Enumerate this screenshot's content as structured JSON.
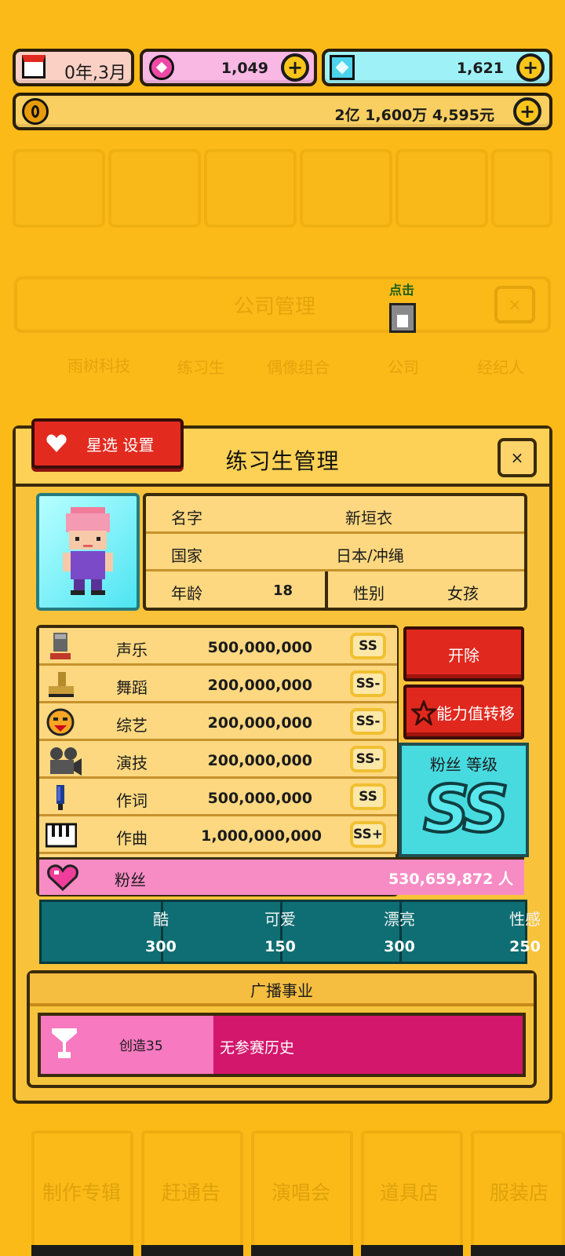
{
  "resources": {
    "date": "0年,3月",
    "gems_pink": "1,049",
    "gems_blue": "1,621",
    "money": "2亿 1,600万 4,595元",
    "plus": "+"
  },
  "background": {
    "company_title": "公司管理",
    "tabs": [
      "雨树科技",
      "练习生",
      "偶像组合",
      "公司",
      "经纪人"
    ],
    "click_hint": "点击",
    "nav": [
      "制作专辑",
      "赶通告",
      "演唱会",
      "道具店",
      "服装店"
    ]
  },
  "panel": {
    "title": "练习生管理",
    "star_setting": "星选 设置",
    "close": "×"
  },
  "profile": {
    "name_label": "名字",
    "name": "新垣衣",
    "country_label": "国家",
    "country": "日本/冲绳",
    "age_label": "年龄",
    "age": "18",
    "gender_label": "性别",
    "gender": "女孩"
  },
  "stats": [
    {
      "label": "声乐",
      "value": "500,000,000",
      "grade": "SS",
      "icon": "microphone-icon"
    },
    {
      "label": "舞蹈",
      "value": "200,000,000",
      "grade": "SS-",
      "icon": "dance-shoe-icon"
    },
    {
      "label": "综艺",
      "value": "200,000,000",
      "grade": "SS-",
      "icon": "variety-face-icon"
    },
    {
      "label": "演技",
      "value": "200,000,000",
      "grade": "SS-",
      "icon": "camera-icon"
    },
    {
      "label": "作词",
      "value": "500,000,000",
      "grade": "SS",
      "icon": "pen-icon"
    },
    {
      "label": "作曲",
      "value": "1,000,000,000",
      "grade": "SS+",
      "icon": "piano-icon"
    }
  ],
  "fans": {
    "label": "粉丝",
    "value": "530,659,872 人"
  },
  "actions": {
    "dismiss": "开除",
    "transfer": "能力值转移"
  },
  "fan_level": {
    "label": "粉丝 等级",
    "grade": "SS"
  },
  "attributes": [
    {
      "name": "酷",
      "value": "300"
    },
    {
      "name": "可爱",
      "value": "150"
    },
    {
      "name": "漂亮",
      "value": "300"
    },
    {
      "name": "性感",
      "value": "250"
    }
  ],
  "broadcast": {
    "title": "广播事业",
    "show": "创造35",
    "history": "无参赛历史"
  },
  "colors": {
    "bg": "#fbba17",
    "panel": "#f8c33a",
    "teal": "#0e6e73",
    "red": "#e0281e",
    "pink": "#f78cc5"
  }
}
